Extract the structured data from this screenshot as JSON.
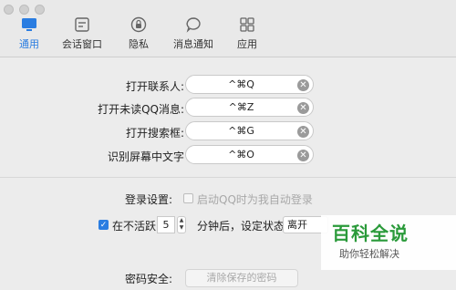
{
  "toolbar": {
    "tabs": [
      {
        "label": "通用",
        "icon": "monitor-icon",
        "active": true
      },
      {
        "label": "会话窗口",
        "icon": "chat-window-icon",
        "active": false
      },
      {
        "label": "隐私",
        "icon": "lock-icon",
        "active": false
      },
      {
        "label": "消息通知",
        "icon": "speech-bubble-icon",
        "active": false
      },
      {
        "label": "应用",
        "icon": "apps-grid-icon",
        "active": false
      }
    ]
  },
  "shortcuts": [
    {
      "label": "打开联系人:",
      "value": "^⌘Q"
    },
    {
      "label": "打开未读QQ消息:",
      "value": "^⌘Z"
    },
    {
      "label": "打开搜索框:",
      "value": "^⌘G"
    },
    {
      "label": "识别屏幕中文字",
      "value": "^⌘O"
    }
  ],
  "login": {
    "label": "登录设置:",
    "auto_login_label": "启动QQ时为我自动登录",
    "auto_login_checked": false
  },
  "idle": {
    "checked": true,
    "prefix": "在不活跃",
    "minutes": "5",
    "suffix": "分钟后，设定状态",
    "status": "离开"
  },
  "password": {
    "label": "密码安全:",
    "clear_button": "清除保存的密码"
  },
  "watermark": {
    "title": "百科全说",
    "subtitle": "助你轻松解决"
  },
  "colors": {
    "accent": "#2a7de1",
    "window_bg": "#ececec",
    "watermark_green": "#2a9a3a"
  }
}
